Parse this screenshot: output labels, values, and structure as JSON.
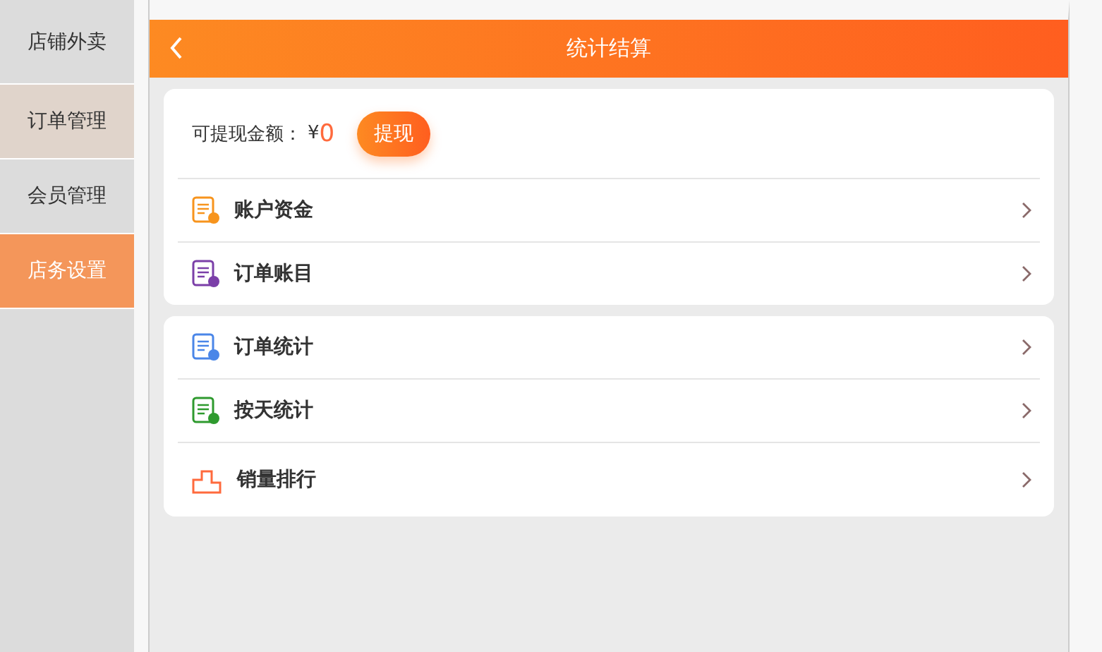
{
  "sidebar": {
    "items": [
      {
        "label": "店铺外卖",
        "selected": false
      },
      {
        "label": "订单管理",
        "selected": false
      },
      {
        "label": "会员管理",
        "selected": false
      },
      {
        "label": "店务设置",
        "selected": true
      }
    ]
  },
  "header": {
    "title": "统计结算"
  },
  "balance": {
    "label": "可提现金额：",
    "currency": "¥",
    "amount": "0",
    "button": "提现"
  },
  "groups": [
    [
      {
        "label": "账户资金",
        "kind": "doc",
        "color": "#f7941d"
      },
      {
        "label": "订单账目",
        "kind": "doc",
        "color": "#7b3fa8"
      }
    ],
    [
      {
        "label": "订单统计",
        "kind": "doc",
        "color": "#4a86e8"
      },
      {
        "label": "按天统计",
        "kind": "doc",
        "color": "#2e9a2e"
      },
      {
        "label": "销量排行",
        "kind": "podium",
        "color": "#ff6a3d"
      }
    ]
  ]
}
